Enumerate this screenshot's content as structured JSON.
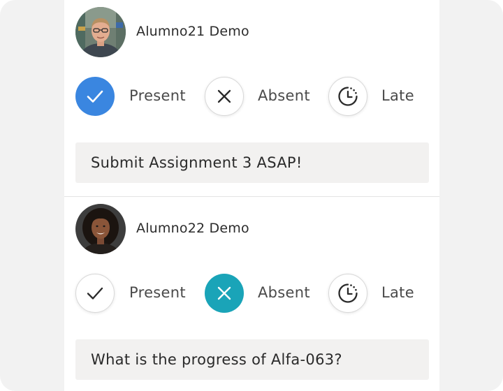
{
  "colors": {
    "present_active": "#3a86e0",
    "absent_active": "#1aa4b8",
    "panel_bg": "#ffffff",
    "page_bg": "#f2f2f2",
    "note_bg": "#f2f1f0"
  },
  "students": [
    {
      "name": "Alumno21 Demo",
      "selected": "present",
      "options": {
        "present_label": "Present",
        "absent_label": "Absent",
        "late_label": "Late"
      },
      "icons": {
        "present": "check-icon",
        "absent": "x-icon",
        "late": "clock-icon"
      },
      "note": "Submit Assignment 3 ASAP!"
    },
    {
      "name": "Alumno22 Demo",
      "selected": "absent",
      "options": {
        "present_label": "Present",
        "absent_label": "Absent",
        "late_label": "Late"
      },
      "icons": {
        "present": "check-icon",
        "absent": "x-icon",
        "late": "clock-icon"
      },
      "note": "What is the progress of Alfa-063?"
    }
  ]
}
